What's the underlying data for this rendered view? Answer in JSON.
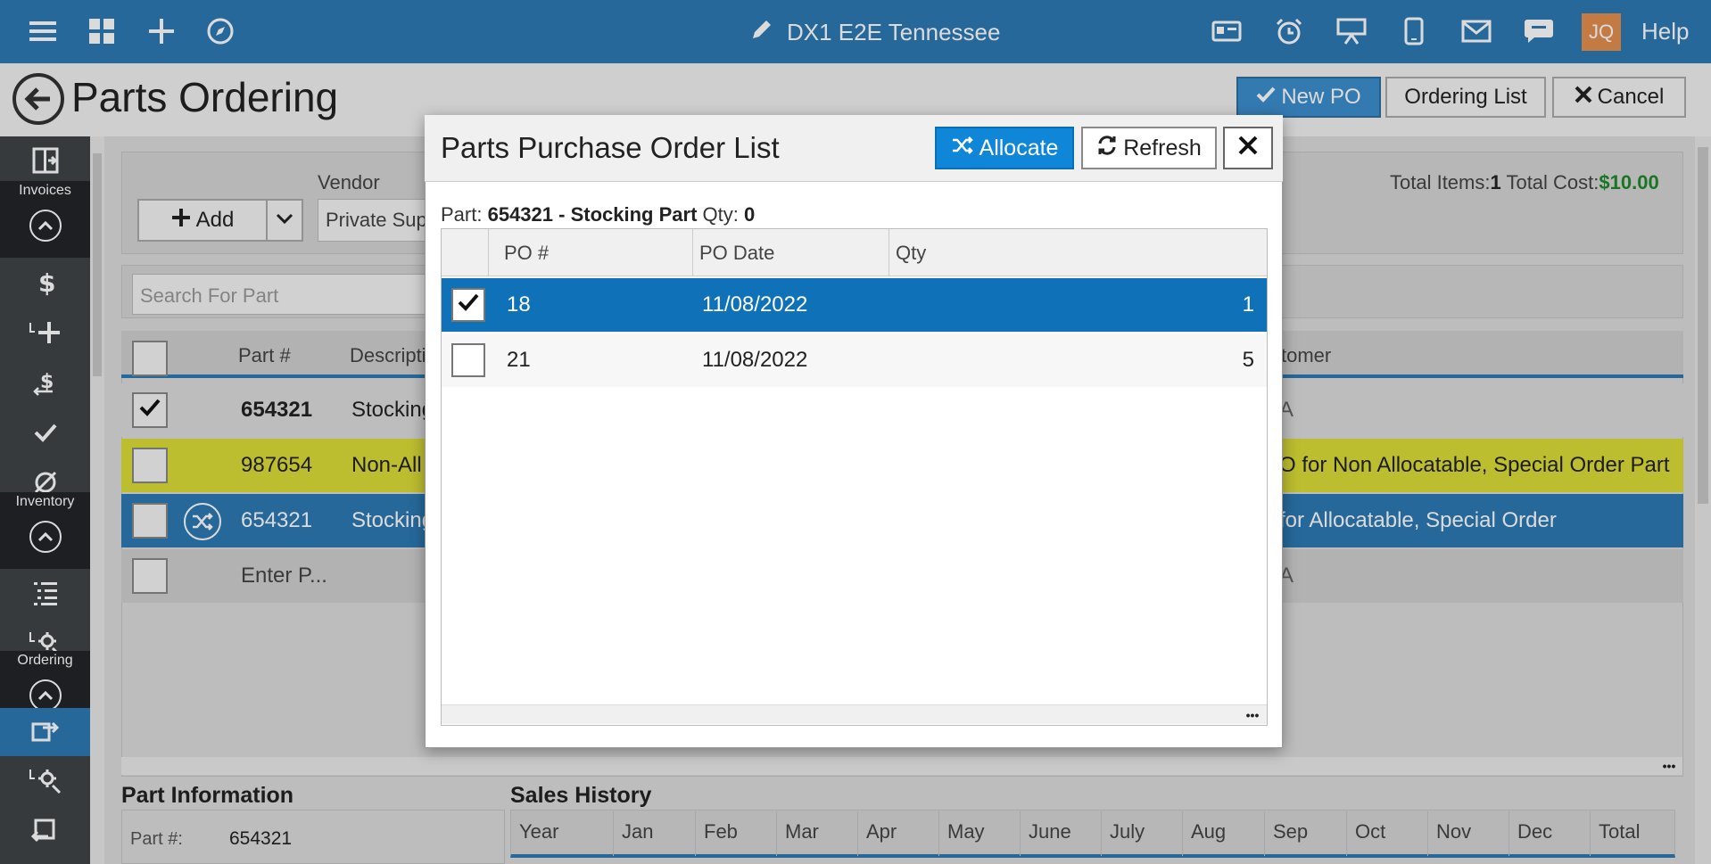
{
  "topbar": {
    "title": "DX1 E2E Tennessee",
    "avatar": "JQ",
    "help": "Help",
    "left_icons": [
      "menu-icon",
      "apps-grid-icon",
      "plus-icon",
      "compass-icon"
    ],
    "right_icons": [
      "license-icon",
      "alarm-clock-icon",
      "presentation-icon",
      "mobile-icon",
      "mail-icon",
      "chat-icon"
    ]
  },
  "header": {
    "page_title": "Parts Ordering",
    "new_po": "New PO",
    "ordering_list": "Ordering List",
    "cancel": "Cancel"
  },
  "sidebar": {
    "groups": [
      "Invoices",
      "Inventory",
      "Ordering"
    ]
  },
  "toolbar": {
    "vendor_label": "Vendor",
    "add_label": "Add",
    "vendor_value": "Private Sup",
    "total_items_label": "Total Items:",
    "total_items": "1",
    "total_cost_label": "Total Cost:",
    "total_cost": "$10.00"
  },
  "search": {
    "placeholder": "Search For Part"
  },
  "parts_grid": {
    "headers": {
      "part": "Part #",
      "desc": "Descripti",
      "customer": "tomer"
    },
    "rows": [
      {
        "part": "654321",
        "desc": "Stocking",
        "customer": "A"
      },
      {
        "part": "987654",
        "desc": "Non-All",
        "customer": "O for Non Allocatable, Special Order Part"
      },
      {
        "part": "654321",
        "desc": "Stocking",
        "customer": "for Allocatable, Special Order"
      },
      {
        "part": "Enter P...",
        "desc": "",
        "customer": "A"
      }
    ]
  },
  "part_info": {
    "title": "Part Information",
    "part_label": "Part #:",
    "part_value": "654321"
  },
  "sales_history": {
    "title": "Sales History",
    "columns": [
      "Year",
      "Jan",
      "Feb",
      "Mar",
      "Apr",
      "May",
      "June",
      "July",
      "Aug",
      "Sep",
      "Oct",
      "Nov",
      "Dec",
      "Total"
    ]
  },
  "modal": {
    "title": "Parts Purchase Order List",
    "allocate": "Allocate",
    "refresh": "Refresh",
    "part_label": "Part:",
    "part_number": "654321",
    "dash": "-",
    "part_type": "Stocking Part",
    "qty_label": "Qty:",
    "qty_value": "0",
    "headers": {
      "po": "PO #",
      "date": "PO Date",
      "qty": "Qty"
    },
    "rows": [
      {
        "po": "18",
        "date": "11/08/2022",
        "qty": "1",
        "checked": true
      },
      {
        "po": "21",
        "date": "11/08/2022",
        "qty": "5",
        "checked": false
      }
    ]
  },
  "colors": {
    "topbar": "#2d7ab4",
    "selected_row": "#0f72b9",
    "highlight_row": "#dcdc38",
    "accent_blue": "#0f86d8",
    "avatar": "#e58f4e",
    "cost_green": "#1e8a2a"
  }
}
